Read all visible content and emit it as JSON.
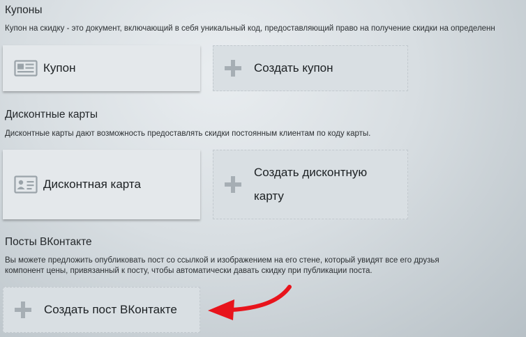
{
  "sections": {
    "coupons": {
      "title": "Купоны",
      "description": "Купон на скидку - это документ, включающий в себя уникальный код, предоставляющий право на получение скидки на определенн",
      "item_card": {
        "label": "Купон",
        "icon": "coupon-icon"
      },
      "create_card": {
        "label": "Создать купон",
        "icon": "plus-icon"
      }
    },
    "discount_cards": {
      "title": "Дисконтные карты",
      "description": "Дисконтные карты дают возможность предоставлять скидки постоянным клиентам по коду карты.",
      "item_card": {
        "label": "Дисконтная карта",
        "icon": "id-card-icon"
      },
      "create_card": {
        "label_line1": "Создать дисконтную",
        "label_line2": "карту",
        "icon": "plus-icon"
      }
    },
    "vk_posts": {
      "title": "Посты ВКонтакте",
      "description_line1": "Вы можете предложить опубликовать пост со ссылкой и изображением на его стене, который увидят все его друзья",
      "description_line2": "компонент цены, привязанный к посту, чтобы автоматически давать скидку при публикации поста.",
      "create_card": {
        "label": "Создать пост ВКонтакте",
        "icon": "plus-icon"
      }
    }
  },
  "annotation": {
    "icon": "red-arrow-icon",
    "color": "#e8141c"
  }
}
